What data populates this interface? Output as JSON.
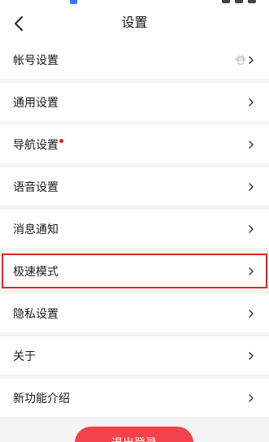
{
  "header": {
    "title": "设置"
  },
  "rows": [
    {
      "label": "帐号设置",
      "has_icon": true
    },
    {
      "label": "通用设置"
    },
    {
      "label": "导航设置",
      "badge": true
    },
    {
      "label": "语音设置"
    },
    {
      "label": "消息通知"
    },
    {
      "label": "极速模式",
      "highlighted": true
    },
    {
      "label": "隐私设置"
    },
    {
      "label": "关于"
    },
    {
      "label": "新功能介绍"
    }
  ],
  "logout": {
    "label": "退出登录"
  },
  "colors": {
    "accent": "#f4424a",
    "highlight": "#e02424",
    "badge": "#e02424"
  }
}
